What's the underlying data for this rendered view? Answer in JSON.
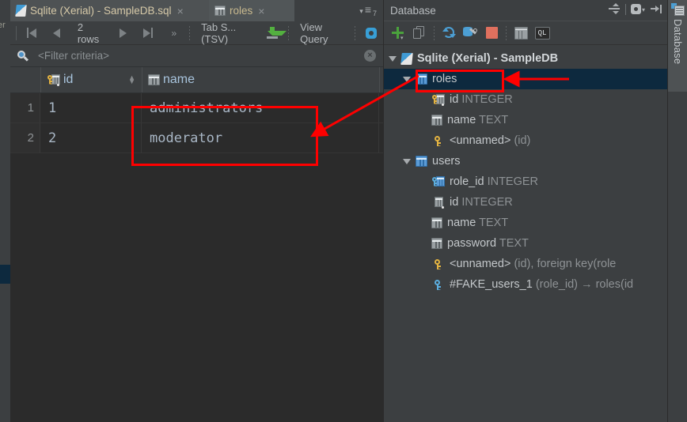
{
  "left_strip": {
    "label": "er",
    "selected_marker": true
  },
  "editor_tabs": [
    {
      "label": "Sqlite (Xerial) - SampleDB.sql",
      "icon": "sql-file-icon",
      "close": "×",
      "active": false
    },
    {
      "label": "roles",
      "icon": "table-icon",
      "close": "×",
      "active": true
    }
  ],
  "tab_menu": {
    "caret": "▾",
    "lines": "≡",
    "count": "7"
  },
  "grid_toolbar": {
    "first_label": "first-page",
    "prev_label": "previous-page",
    "rows_label": "2 rows",
    "next_label": "next-page",
    "last_label": "last-page",
    "more_label": "»",
    "format_label": "Tab S...(TSV)",
    "export_label": "export-to-file",
    "view_query_label": "View Query",
    "settings_label": "data-source-settings"
  },
  "filter": {
    "placeholder": "<Filter criteria>",
    "value": "",
    "clear_label": "×",
    "search_icon": "search-icon"
  },
  "grid": {
    "columns": [
      {
        "label": "id",
        "icon": "primary-key-column-icon",
        "sortable": true,
        "sort_glyph": "⇅"
      },
      {
        "label": "name",
        "icon": "column-icon",
        "sortable": false,
        "sort_glyph": ""
      }
    ],
    "rows": [
      {
        "num": "1",
        "id": "1",
        "name": "administrators"
      },
      {
        "num": "2",
        "id": "2",
        "name": "moderator"
      }
    ]
  },
  "database_panel": {
    "title": "Database",
    "header_tools": [
      {
        "name": "expand-collapse-icon",
        "glyph": "≢"
      },
      {
        "name": "settings-gear-icon",
        "glyph": "⚙"
      },
      {
        "name": "hide-panel-icon",
        "glyph": "→|"
      }
    ],
    "toolbar": [
      {
        "name": "add-data-source-button",
        "glyph": "+"
      },
      {
        "name": "duplicate-button",
        "glyph": "⧉"
      },
      {
        "name": "synchronize-button",
        "glyph": "↻"
      },
      {
        "name": "data-source-properties-button",
        "glyph": "ὒ7"
      },
      {
        "name": "stop-button",
        "glyph": "■"
      },
      {
        "name": "jump-to-table-button",
        "glyph": "▦"
      },
      {
        "name": "open-console-button",
        "glyph": "QL"
      }
    ],
    "tree": [
      {
        "id": "datasource",
        "label": "Sqlite (Xerial) - SampleDB",
        "type": "",
        "icon": "sqlite-datasource-icon",
        "indent": 0,
        "expanded": true,
        "selected": false,
        "bold": true
      },
      {
        "id": "roles",
        "label": "roles",
        "type": "",
        "icon": "table-icon",
        "indent": 1,
        "expanded": true,
        "selected": true,
        "bold": false
      },
      {
        "id": "roles.id",
        "label": "id",
        "type": "INTEGER",
        "icon": "primary-key-column-icon",
        "indent": 2,
        "expanded": null,
        "selected": false,
        "bold": false
      },
      {
        "id": "roles.name",
        "label": "name",
        "type": "TEXT",
        "icon": "column-icon",
        "indent": 2,
        "expanded": null,
        "selected": false,
        "bold": false
      },
      {
        "id": "roles.pk",
        "label": "<unnamed>",
        "type": "(id)",
        "icon": "primary-key-icon",
        "indent": 2,
        "expanded": null,
        "selected": false,
        "bold": false
      },
      {
        "id": "users",
        "label": "users",
        "type": "",
        "icon": "table-icon",
        "indent": 1,
        "expanded": true,
        "selected": false,
        "bold": false
      },
      {
        "id": "users.role_id",
        "label": "role_id",
        "type": "INTEGER",
        "icon": "foreign-key-column-icon",
        "indent": 2,
        "expanded": null,
        "selected": false,
        "bold": false
      },
      {
        "id": "users.id",
        "label": "id",
        "type": "INTEGER",
        "icon": "column-icon",
        "indent": 2,
        "expanded": null,
        "selected": false,
        "bold": false
      },
      {
        "id": "users.name",
        "label": "name",
        "type": "TEXT",
        "icon": "column-icon",
        "indent": 2,
        "expanded": null,
        "selected": false,
        "bold": false
      },
      {
        "id": "users.password",
        "label": "password",
        "type": "TEXT",
        "icon": "column-icon",
        "indent": 2,
        "expanded": null,
        "selected": false,
        "bold": false
      },
      {
        "id": "users.pk",
        "label": "<unnamed>",
        "type": "(id), foreign key(role",
        "icon": "primary-key-icon",
        "indent": 2,
        "expanded": null,
        "selected": false,
        "bold": false
      },
      {
        "id": "users.fk",
        "label": "#FAKE_users_1",
        "type": "(role_id) → roles(id",
        "icon": "foreign-key-icon",
        "indent": 2,
        "expanded": null,
        "selected": false,
        "bold": false
      }
    ]
  },
  "right_strip": {
    "label": "Database",
    "icon": "database-tool-window-icon"
  },
  "annotations": {
    "color": "#fe0000",
    "boxes": [
      {
        "name": "grid-name-values-box"
      },
      {
        "name": "tree-roles-node-box"
      }
    ],
    "arrows": [
      {
        "name": "arrow-tree-to-grid"
      },
      {
        "name": "arrow-pointing-to-roles"
      }
    ]
  }
}
